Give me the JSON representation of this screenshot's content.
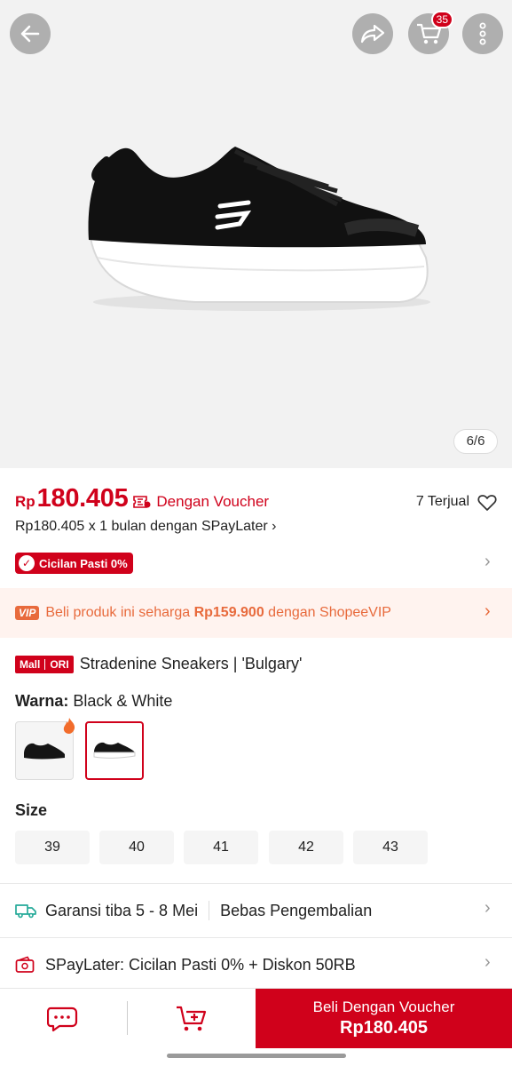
{
  "gallery": {
    "counter": "6/6"
  },
  "header": {
    "cart_count": "35"
  },
  "price": {
    "currency": "Rp",
    "amount": "180.405",
    "voucher_label": "Dengan Voucher",
    "sold": "7 Terjual",
    "spaylater": "Rp180.405 x 1 bulan dengan SPayLater",
    "cicilan_badge": "Cicilan Pasti 0%"
  },
  "vip": {
    "tag": "VIP",
    "text_before": "Beli produk ini seharga ",
    "vip_price": "Rp159.900",
    "text_after": " dengan ShopeeVIP"
  },
  "product": {
    "mall_label": "Mall",
    "ori_label": "ORI",
    "title": "Stradenine Sneakers | 'Bulgary'",
    "variant_key": "Warna:",
    "variant_value": "Black & White",
    "size_label": "Size",
    "sizes": [
      "39",
      "40",
      "41",
      "42",
      "43"
    ]
  },
  "shipping": {
    "guarantee": "Garansi tiba 5 - 8 Mei",
    "returns": "Bebas Pengembalian"
  },
  "promo": {
    "text": "SPayLater: Cicilan Pasti 0% + Diskon 50RB"
  },
  "bottom": {
    "buy_label": "Beli Dengan Voucher",
    "buy_price": "Rp180.405"
  },
  "colors": {
    "accent": "#d0011b",
    "vip": "#e86a3c",
    "vip_bg": "#fff3ef"
  },
  "icons": [
    "back-arrow-icon",
    "share-icon",
    "cart-icon",
    "more-vertical-icon",
    "voucher-icon",
    "heart-icon",
    "check-icon",
    "chevron-right-icon",
    "flame-icon",
    "truck-icon",
    "wallet-icon",
    "chat-icon",
    "add-to-cart-icon"
  ]
}
